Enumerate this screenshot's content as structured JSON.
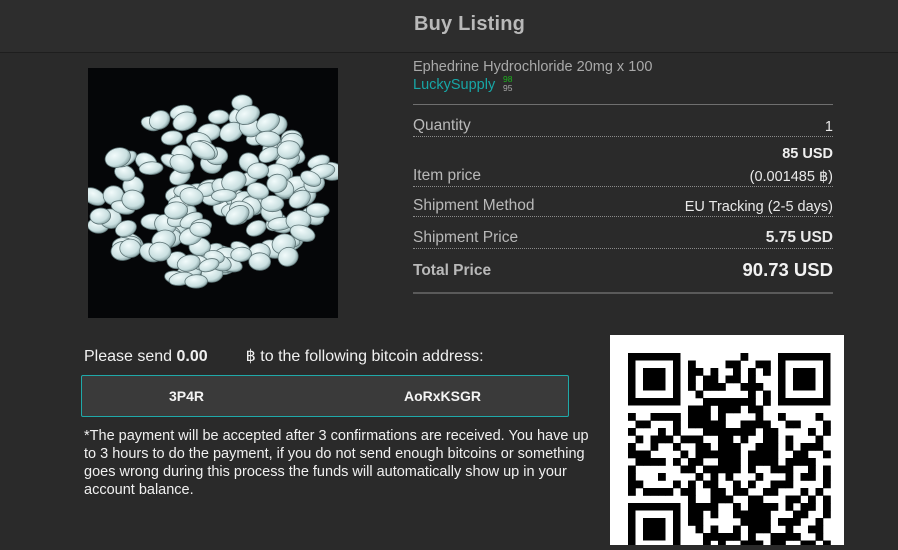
{
  "header": {
    "title": "Buy Listing"
  },
  "product": {
    "image_icon": "white-pills-photo",
    "name": "Ephedrine Hydrochloride 20mg x 100",
    "vendor": "LuckySupply",
    "vendor_positive": "98",
    "vendor_negative": "95"
  },
  "order": {
    "quantity_label": "Quantity",
    "quantity_value": "1",
    "item_price_usd": "85 USD",
    "item_price_label": "Item price",
    "item_price_btc": "(0.001485 ฿)",
    "shipment_method_label": "Shipment Method",
    "shipment_method_value": "EU Tracking (2-5 days)",
    "shipment_price_label": "Shipment Price",
    "shipment_price_value": "5.75 USD",
    "total_label": "Total Price",
    "total_value": "90.73 USD"
  },
  "payment": {
    "send_prefix": "Please send ",
    "send_amount": "0.00",
    "send_suffix": "฿ to the following bitcoin address:",
    "address_start": "3P4R",
    "address_end": "AoRxKSGR",
    "note": "*The payment will be accepted after 3 confirmations are received. You have up to 3 hours to do the payment, if you do not send enough bitcoins or something goes wrong during this process the funds will automatically show up in your account balance.",
    "qr_icon": "bitcoin-address-qr-code"
  },
  "colors": {
    "background": "#2a2a2a",
    "accent": "#17a6a6",
    "positive": "#1db31d"
  }
}
